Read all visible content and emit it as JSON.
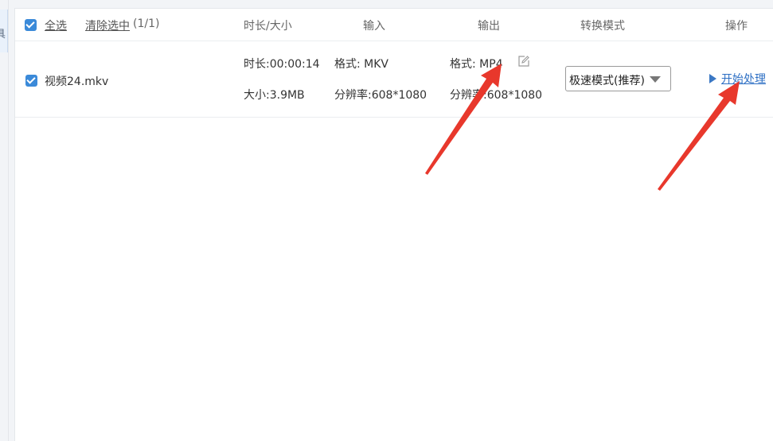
{
  "sidebar": {
    "tab_glyph": "具"
  },
  "header": {
    "select_all_label": "全选",
    "clear_selection_label": "清除选中",
    "selection_count": "(1/1)",
    "col_duration_size": "时长/大小",
    "col_input": "输入",
    "col_output": "输出",
    "col_mode": "转换模式",
    "col_action": "操作"
  },
  "rows": [
    {
      "file_name": "视频24.mkv",
      "duration": "时长:00:00:14",
      "size": "大小:3.9MB",
      "input_format": "格式: MKV",
      "input_resolution": "分辨率:608*1080",
      "output_format": "格式: MP4",
      "output_resolution": "分辨率:608*1080",
      "mode_selected": "极速模式(推荐)",
      "action_label": "开始处理"
    }
  ],
  "colors": {
    "checkbox": "#3b8ad9",
    "link_blue": "#2d6fc4",
    "annotation_arrow": "#e8382c"
  },
  "icons": {
    "edit": "edit-icon",
    "play": "play-icon",
    "dropdown": "chevron-down-icon"
  }
}
